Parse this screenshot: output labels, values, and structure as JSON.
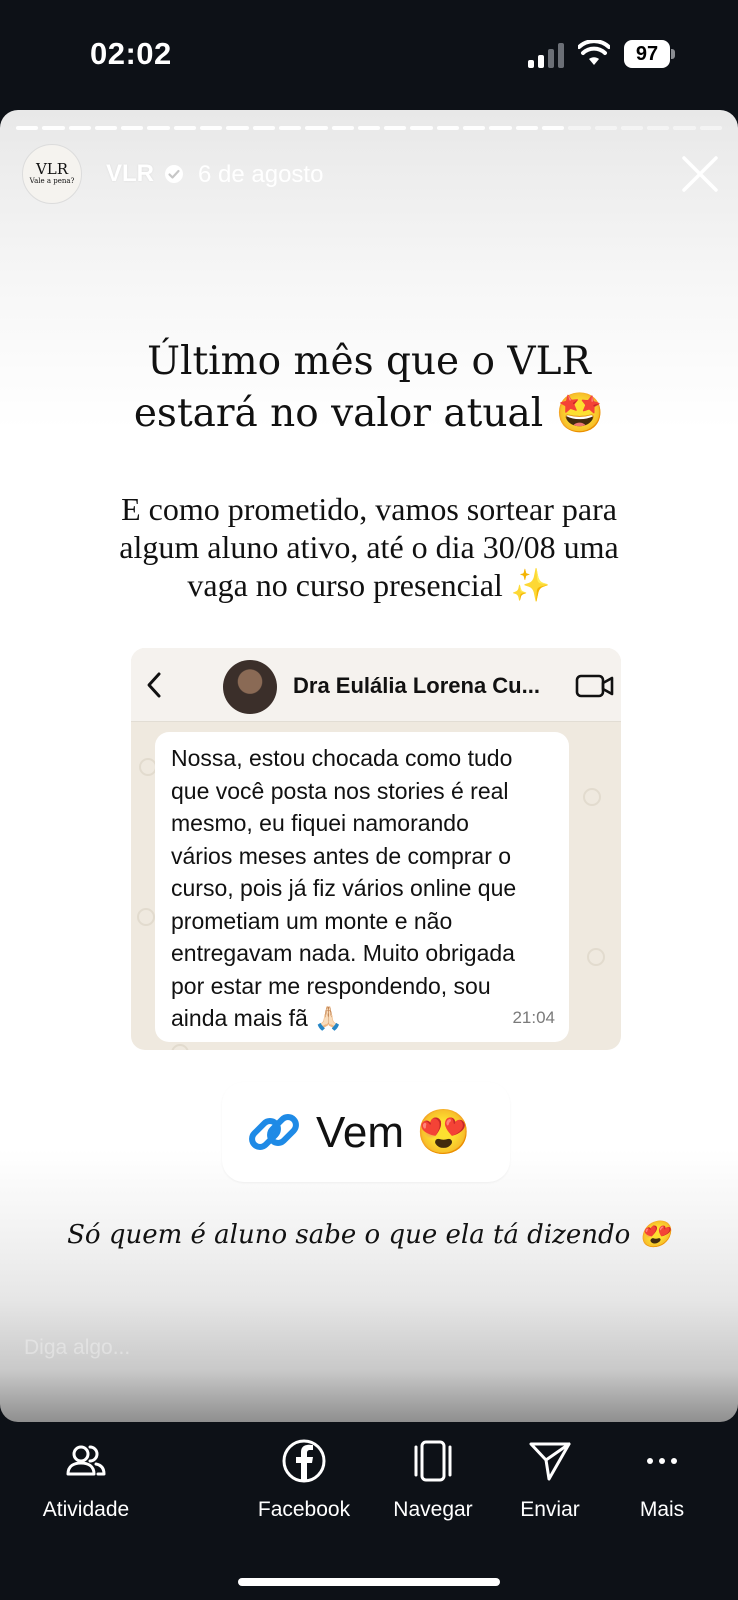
{
  "status_bar": {
    "time": "02:02",
    "battery": "97"
  },
  "story": {
    "account": "VLR",
    "avatar_logo": "VLR",
    "avatar_tagline": "Vale a pena?",
    "date": "6 de agosto",
    "verified": true,
    "headline_line1": "Último mês que o VLR",
    "headline_line2": "estará no valor atual 🤩",
    "body_line1": "E como prometido, vamos sortear para",
    "body_line2": "algum aluno ativo, até o dia 30/08 uma",
    "body_line3": "vaga no curso presencial ✨",
    "chat": {
      "contact_name": "Dra Eulália Lorena Cu...",
      "message_lines": [
        "Nossa, estou chocada como tudo",
        "que você posta nos stories é real",
        "mesmo, eu fiquei namorando",
        "vários meses antes de comprar o",
        "curso, pois já fiz vários online que",
        "prometiam um monte e não",
        "entregavam nada. Muito obrigada",
        "por estar me respondendo, sou",
        "ainda mais fã 🙏🏻"
      ],
      "time": "21:04"
    },
    "link_sticker": "Vem 😍",
    "caption": "Só quem é aluno sabe o que ela tá dizendo 😍",
    "reply_placeholder": "Diga algo..."
  },
  "bottom_nav": {
    "activity": "Atividade",
    "facebook": "Facebook",
    "browse": "Navegar",
    "send": "Enviar",
    "more": "Mais"
  },
  "colors": {
    "background": "#0d1117",
    "link_blue": "#1e8ae6"
  }
}
